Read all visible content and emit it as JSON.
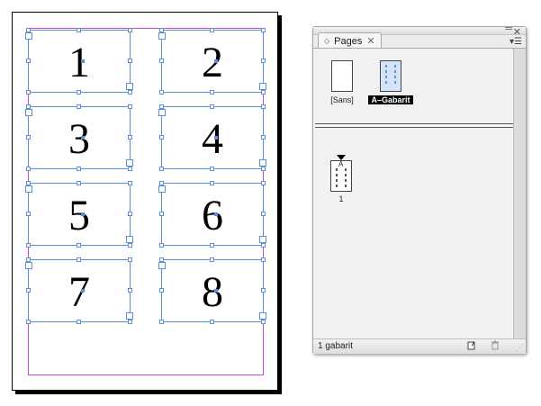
{
  "document": {
    "frames": [
      {
        "number": "1"
      },
      {
        "number": "2"
      },
      {
        "number": "3"
      },
      {
        "number": "4"
      },
      {
        "number": "5"
      },
      {
        "number": "6"
      },
      {
        "number": "7"
      },
      {
        "number": "8"
      }
    ]
  },
  "panel": {
    "tab_label": "Pages",
    "collapse_icon": "double-arrow-icon",
    "close_icon": "close-icon",
    "menu_icon": "panel-menu-icon",
    "masters": [
      {
        "label": "[Sans]",
        "selected": false
      },
      {
        "label": "A–Gabarit",
        "selected": true
      }
    ],
    "pages": [
      {
        "label": "1",
        "master_prefix": "A"
      }
    ],
    "status": "1 gabarit",
    "new_page_icon": "new-page-icon",
    "delete_icon": "trash-icon",
    "colors": {
      "frame_blue": "#5b8fd6",
      "margin_magenta": "#c44bd0",
      "selected_label_bg": "#000000"
    }
  }
}
